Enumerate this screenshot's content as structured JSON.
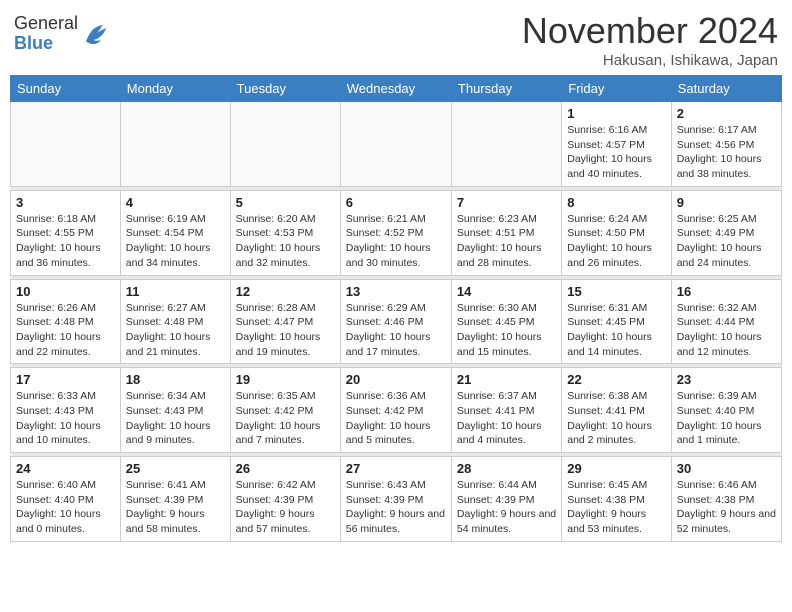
{
  "logo": {
    "general": "General",
    "blue": "Blue"
  },
  "title": "November 2024",
  "location": "Hakusan, Ishikawa, Japan",
  "days_of_week": [
    "Sunday",
    "Monday",
    "Tuesday",
    "Wednesday",
    "Thursday",
    "Friday",
    "Saturday"
  ],
  "weeks": [
    [
      {
        "day": "",
        "info": ""
      },
      {
        "day": "",
        "info": ""
      },
      {
        "day": "",
        "info": ""
      },
      {
        "day": "",
        "info": ""
      },
      {
        "day": "",
        "info": ""
      },
      {
        "day": "1",
        "info": "Sunrise: 6:16 AM\nSunset: 4:57 PM\nDaylight: 10 hours and 40 minutes."
      },
      {
        "day": "2",
        "info": "Sunrise: 6:17 AM\nSunset: 4:56 PM\nDaylight: 10 hours and 38 minutes."
      }
    ],
    [
      {
        "day": "3",
        "info": "Sunrise: 6:18 AM\nSunset: 4:55 PM\nDaylight: 10 hours and 36 minutes."
      },
      {
        "day": "4",
        "info": "Sunrise: 6:19 AM\nSunset: 4:54 PM\nDaylight: 10 hours and 34 minutes."
      },
      {
        "day": "5",
        "info": "Sunrise: 6:20 AM\nSunset: 4:53 PM\nDaylight: 10 hours and 32 minutes."
      },
      {
        "day": "6",
        "info": "Sunrise: 6:21 AM\nSunset: 4:52 PM\nDaylight: 10 hours and 30 minutes."
      },
      {
        "day": "7",
        "info": "Sunrise: 6:23 AM\nSunset: 4:51 PM\nDaylight: 10 hours and 28 minutes."
      },
      {
        "day": "8",
        "info": "Sunrise: 6:24 AM\nSunset: 4:50 PM\nDaylight: 10 hours and 26 minutes."
      },
      {
        "day": "9",
        "info": "Sunrise: 6:25 AM\nSunset: 4:49 PM\nDaylight: 10 hours and 24 minutes."
      }
    ],
    [
      {
        "day": "10",
        "info": "Sunrise: 6:26 AM\nSunset: 4:48 PM\nDaylight: 10 hours and 22 minutes."
      },
      {
        "day": "11",
        "info": "Sunrise: 6:27 AM\nSunset: 4:48 PM\nDaylight: 10 hours and 21 minutes."
      },
      {
        "day": "12",
        "info": "Sunrise: 6:28 AM\nSunset: 4:47 PM\nDaylight: 10 hours and 19 minutes."
      },
      {
        "day": "13",
        "info": "Sunrise: 6:29 AM\nSunset: 4:46 PM\nDaylight: 10 hours and 17 minutes."
      },
      {
        "day": "14",
        "info": "Sunrise: 6:30 AM\nSunset: 4:45 PM\nDaylight: 10 hours and 15 minutes."
      },
      {
        "day": "15",
        "info": "Sunrise: 6:31 AM\nSunset: 4:45 PM\nDaylight: 10 hours and 14 minutes."
      },
      {
        "day": "16",
        "info": "Sunrise: 6:32 AM\nSunset: 4:44 PM\nDaylight: 10 hours and 12 minutes."
      }
    ],
    [
      {
        "day": "17",
        "info": "Sunrise: 6:33 AM\nSunset: 4:43 PM\nDaylight: 10 hours and 10 minutes."
      },
      {
        "day": "18",
        "info": "Sunrise: 6:34 AM\nSunset: 4:43 PM\nDaylight: 10 hours and 9 minutes."
      },
      {
        "day": "19",
        "info": "Sunrise: 6:35 AM\nSunset: 4:42 PM\nDaylight: 10 hours and 7 minutes."
      },
      {
        "day": "20",
        "info": "Sunrise: 6:36 AM\nSunset: 4:42 PM\nDaylight: 10 hours and 5 minutes."
      },
      {
        "day": "21",
        "info": "Sunrise: 6:37 AM\nSunset: 4:41 PM\nDaylight: 10 hours and 4 minutes."
      },
      {
        "day": "22",
        "info": "Sunrise: 6:38 AM\nSunset: 4:41 PM\nDaylight: 10 hours and 2 minutes."
      },
      {
        "day": "23",
        "info": "Sunrise: 6:39 AM\nSunset: 4:40 PM\nDaylight: 10 hours and 1 minute."
      }
    ],
    [
      {
        "day": "24",
        "info": "Sunrise: 6:40 AM\nSunset: 4:40 PM\nDaylight: 10 hours and 0 minutes."
      },
      {
        "day": "25",
        "info": "Sunrise: 6:41 AM\nSunset: 4:39 PM\nDaylight: 9 hours and 58 minutes."
      },
      {
        "day": "26",
        "info": "Sunrise: 6:42 AM\nSunset: 4:39 PM\nDaylight: 9 hours and 57 minutes."
      },
      {
        "day": "27",
        "info": "Sunrise: 6:43 AM\nSunset: 4:39 PM\nDaylight: 9 hours and 56 minutes."
      },
      {
        "day": "28",
        "info": "Sunrise: 6:44 AM\nSunset: 4:39 PM\nDaylight: 9 hours and 54 minutes."
      },
      {
        "day": "29",
        "info": "Sunrise: 6:45 AM\nSunset: 4:38 PM\nDaylight: 9 hours and 53 minutes."
      },
      {
        "day": "30",
        "info": "Sunrise: 6:46 AM\nSunset: 4:38 PM\nDaylight: 9 hours and 52 minutes."
      }
    ]
  ]
}
